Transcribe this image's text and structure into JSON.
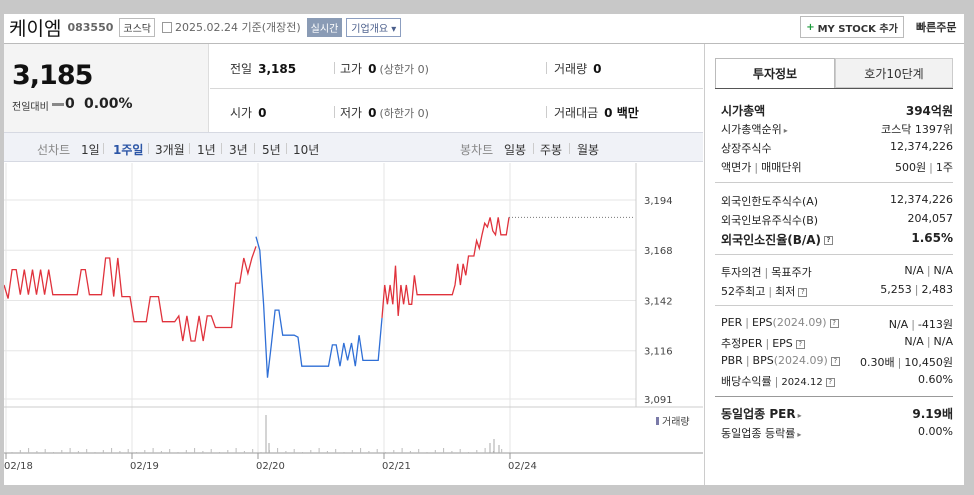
{
  "header": {
    "name": "케이엠",
    "code": "083550",
    "market": "코스닥",
    "date": "2025.02.24 기준(개장전)",
    "realtime": "실시간",
    "corp_summary": "기업개요",
    "mystock": "MY STOCK 추가",
    "mystock_plus": "+",
    "quick_order": "빠른주문"
  },
  "price": {
    "current": "3,185",
    "change_label": "전일대비",
    "change": "0",
    "change_pct": "0.00%"
  },
  "stats": {
    "prev_label": "전일",
    "prev": "3,185",
    "high_label": "고가",
    "high": "0",
    "high_limit": "(상한가 0)",
    "volume_label": "거래량",
    "volume": "0",
    "open_label": "시가",
    "open": "0",
    "low_label": "저가",
    "low": "0",
    "low_limit": "(하한가 0)",
    "amount_label": "거래대금",
    "amount": "0 백만"
  },
  "tabs": {
    "line_chart": "선차트",
    "periods": [
      "1일",
      "1주일",
      "3개월",
      "1년",
      "3년",
      "5년",
      "10년"
    ],
    "active_period": "1주일",
    "candle_chart": "봉차트",
    "candles": [
      "일봉",
      "주봉",
      "월봉"
    ]
  },
  "chart_data": {
    "type": "line",
    "x_ticks": [
      "02/18",
      "02/19",
      "02/20",
      "02/21",
      "02/24"
    ],
    "y_ticks": [
      "3,194",
      "3,168",
      "3,142",
      "3,116",
      "3,091"
    ],
    "ylim": [
      3091,
      3194
    ],
    "volume_label": "거래량",
    "series": [
      {
        "color": "#e0323c",
        "values": [
          3150,
          3143,
          3158,
          3158,
          3145,
          3158,
          3145,
          3158,
          3145,
          3158,
          3145,
          3158,
          3145,
          3145,
          3145,
          3145,
          3145,
          3145,
          3145,
          3158,
          3158,
          3145,
          3145,
          3145,
          3145,
          3164,
          3164,
          3144,
          3164,
          3144,
          3144,
          3144,
          3131,
          3131,
          3131,
          3131,
          3144,
          3144,
          3144,
          3131,
          3131,
          3131,
          3131,
          3134,
          3121,
          3134,
          3121,
          3121,
          3134,
          3121,
          3134,
          3134,
          3128,
          3128,
          3128,
          3128,
          3128,
          3151,
          3151,
          3164,
          3156,
          3164,
          3170
        ]
      },
      {
        "color": "#2f6fd6",
        "values": [
          3175,
          3168,
          3140,
          3102,
          3119,
          3137,
          3137,
          3124,
          3124,
          3124,
          3124,
          3123,
          3108,
          3108,
          3108,
          3108,
          3108,
          3108,
          3108,
          3108,
          3119,
          3119,
          3108,
          3120,
          3111,
          3120,
          3108,
          3124,
          3111,
          3111,
          3111,
          3111,
          3111,
          3133
        ]
      },
      {
        "color": "#e0323c",
        "values": [
          3133,
          3150,
          3140,
          3150,
          3140,
          3160,
          3134,
          3150,
          3140,
          3150,
          3140,
          3140,
          3155,
          3145,
          3145,
          3145,
          3145,
          3145,
          3145,
          3145,
          3145,
          3145,
          3145,
          3145,
          3145,
          3145,
          3145,
          3150,
          3161,
          3150,
          3161,
          3155,
          3165,
          3165,
          3165,
          3173,
          3169,
          3176,
          3182,
          3180,
          3185,
          3178,
          3176,
          3185,
          3176,
          3176,
          3176,
          3185
        ]
      }
    ],
    "reference_price": 3185
  },
  "invest": {
    "tab1": "투자정보",
    "tab2": "호가10단계",
    "market_cap_label": "시가총액",
    "market_cap": "394억원",
    "cap_rank_label": "시가총액순위",
    "cap_rank": "코스닥 1397위",
    "shares_label": "상장주식수",
    "shares": "12,374,226",
    "par_label": "액면가",
    "par_sep": "|",
    "unit_label": "매매단위",
    "par": "500원",
    "unit": "1주",
    "foreign_limit_label": "외국인한도주식수(A)",
    "foreign_limit": "12,374,226",
    "foreign_hold_label": "외국인보유주식수(B)",
    "foreign_hold": "204,057",
    "foreign_ratio_label": "외국인소진율(B/A)",
    "foreign_ratio": "1.65%",
    "opinion_label": "투자의견",
    "opinion_sep": "|",
    "target_label": "목표주가",
    "opinion": "N/A",
    "target": "N/A",
    "w52_label": "52주최고",
    "w52_sep": "|",
    "w52_low_label": "최저",
    "w52_high": "5,253",
    "w52_low": "2,483",
    "per_label": "PER",
    "per_sep": "|",
    "eps_label": "EPS",
    "eps_year": "(2024.09)",
    "per": "N/A",
    "eps": "-413원",
    "est_per_label": "추정PER",
    "est_sep": "|",
    "est_eps_label": "EPS",
    "est_per": "N/A",
    "est_eps": "N/A",
    "pbr_label": "PBR",
    "pbr_sep": "|",
    "bps_label": "BPS",
    "bps_year": "(2024.09)",
    "pbr": "0.30배",
    "bps": "10,450원",
    "div_label": "배당수익률",
    "div_sep": "|",
    "div_year": "2024.12",
    "div": "0.60%",
    "ind_per_label": "동일업종 PER",
    "ind_per": "9.19배",
    "ind_chg_label": "동일업종 등락률",
    "ind_chg": "0.00%"
  }
}
